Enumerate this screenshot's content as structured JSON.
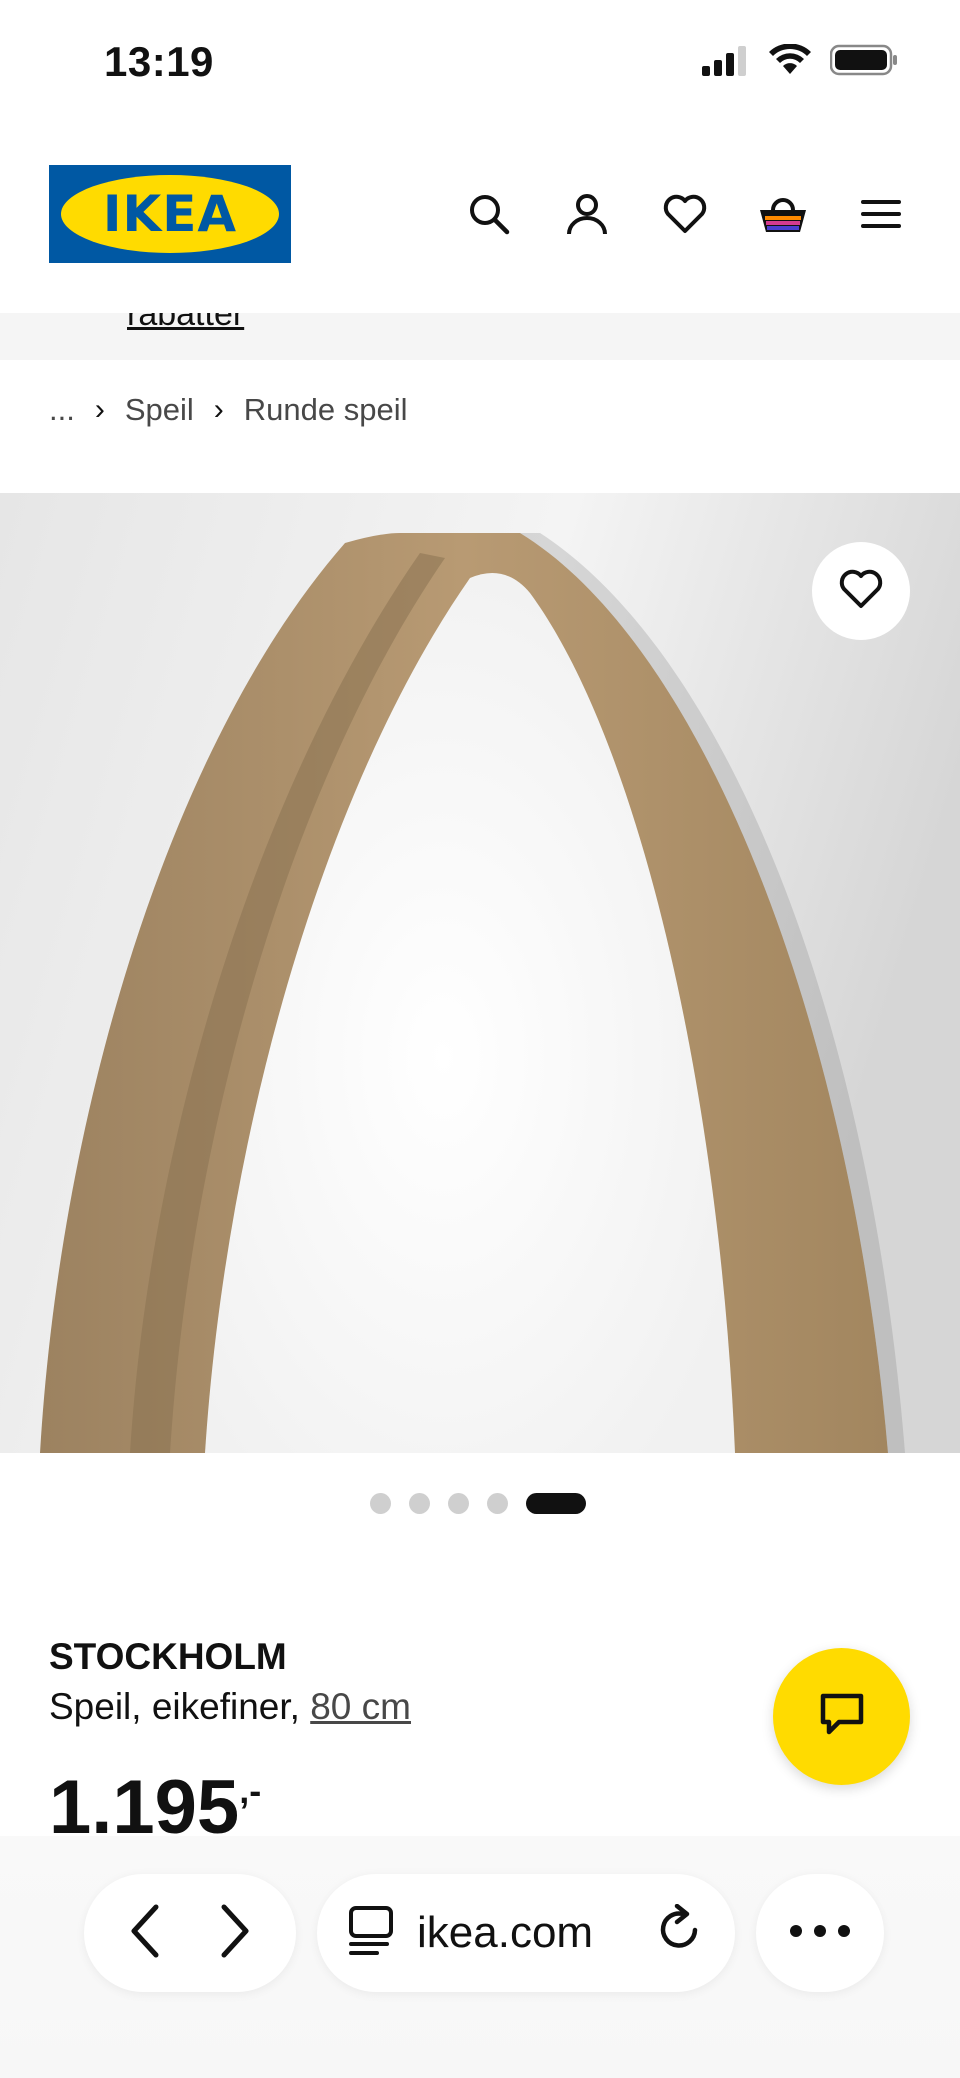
{
  "status_bar": {
    "time": "13:19",
    "icons": [
      "signal-icon",
      "wifi-icon",
      "battery-icon"
    ]
  },
  "header": {
    "logo_text": "IKEA",
    "icons": [
      "search-icon",
      "account-icon",
      "heart-icon",
      "basket-icon",
      "menu-icon"
    ]
  },
  "banner": {
    "text": "rabatter"
  },
  "breadcrumb": {
    "items": [
      "...",
      "Speil",
      "Runde speil"
    ],
    "separator": "›"
  },
  "product": {
    "image_alt": "Round oak veneer mirror",
    "carousel_count": 5,
    "carousel_active_index": 4,
    "name": "STOCKHOLM",
    "description": "Speil, eikefiner, ",
    "size": "80 cm",
    "price": "1.195",
    "price_suffix": ",-"
  },
  "browser": {
    "url": "ikea.com",
    "back_icon": "chevron-left-icon",
    "forward_icon": "chevron-right-icon",
    "tabs_icon": "tabs-icon",
    "reload_icon": "reload-icon",
    "more_icon": "more-icon"
  },
  "colors": {
    "brand_blue": "#0058a3",
    "brand_yellow": "#ffdb00",
    "text": "#111111",
    "muted": "#484848"
  }
}
